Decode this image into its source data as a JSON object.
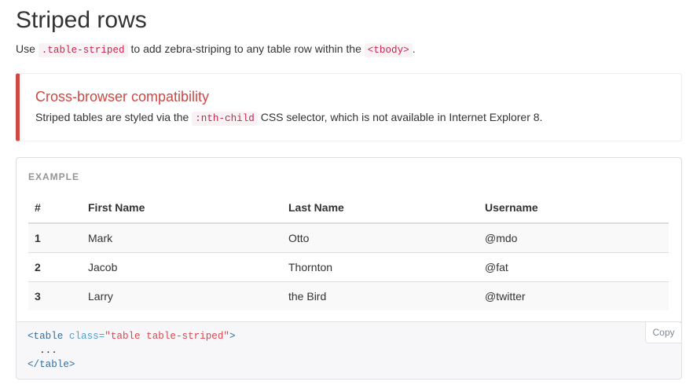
{
  "heading": "Striped rows",
  "lead": {
    "text_before": "Use ",
    "code_class": ".table-striped",
    "text_middle": " to add zebra-striping to any table row within the ",
    "code_tbody": "<tbody>",
    "text_after": "."
  },
  "callout": {
    "title": "Cross-browser compatibility",
    "text_before": "Striped tables are styled via the ",
    "code": ":nth-child",
    "text_after": " CSS selector, which is not available in Internet Explorer 8.",
    "accent_color": "#ce4844"
  },
  "example": {
    "label": "Example",
    "table": {
      "headers": [
        "#",
        "First Name",
        "Last Name",
        "Username"
      ],
      "rows": [
        [
          "1",
          "Mark",
          "Otto",
          "@mdo"
        ],
        [
          "2",
          "Jacob",
          "Thornton",
          "@fat"
        ],
        [
          "3",
          "Larry",
          "the Bird",
          "@twitter"
        ]
      ]
    }
  },
  "code": {
    "line1_open": "<table",
    "line1_attr": " class=",
    "line1_value": "\"table table-striped\"",
    "line1_close": ">",
    "line2": "  ...",
    "line3": "</table>",
    "copy_label": "Copy"
  }
}
